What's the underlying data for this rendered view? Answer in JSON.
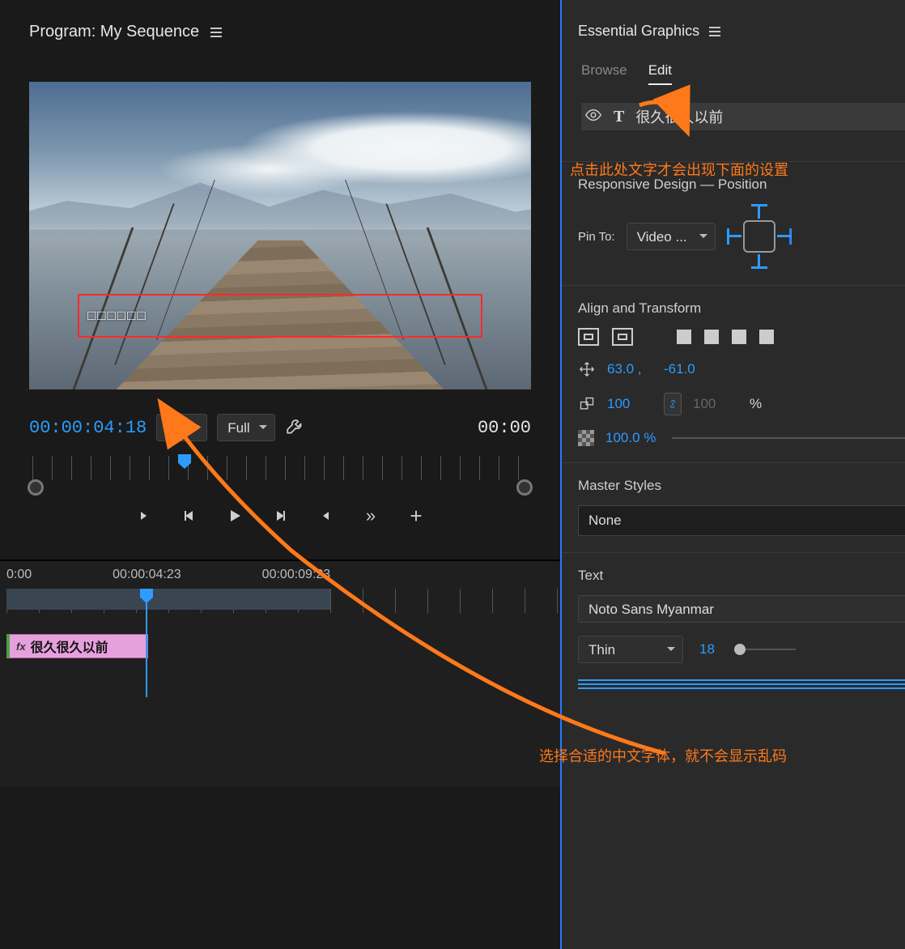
{
  "program": {
    "title": "Program: My Sequence",
    "title_text": "□□□□□□",
    "timecode_left": "00:00:04:18",
    "timecode_right": "00:00",
    "zoom_options": [
      "Fit"
    ],
    "zoom_selected": "Fit",
    "quality_options": [
      "Full"
    ],
    "quality_selected": "Full"
  },
  "timeline": {
    "ticks": [
      "0:00",
      "00:00:04:23",
      "00:00:09:23"
    ],
    "clip_label": "很久很久以前",
    "fx_label": "fx"
  },
  "essential_graphics": {
    "panel_title": "Essential Graphics",
    "tabs": {
      "browse": "Browse",
      "edit": "Edit"
    },
    "layer_text": "很久很久以前",
    "annotation1": "点击此处文字才会出现下面的设置",
    "annotation2": "选择合适的中文字体，就不会显示乱码",
    "responsive": {
      "label": "Responsive Design — Position",
      "pin_to": "Pin To:",
      "pin_target": "Video ..."
    },
    "align": {
      "label": "Align and Transform",
      "pos_x": "63.0 ,",
      "pos_y": "-61.0",
      "scale_a": "100",
      "scale_b": "100",
      "scale_unit": "%",
      "opacity": "100.0 %"
    },
    "master": {
      "label": "Master Styles",
      "value": "None"
    },
    "text": {
      "label": "Text",
      "font": "Noto Sans Myanmar",
      "weight": "Thin",
      "size": "18"
    }
  }
}
